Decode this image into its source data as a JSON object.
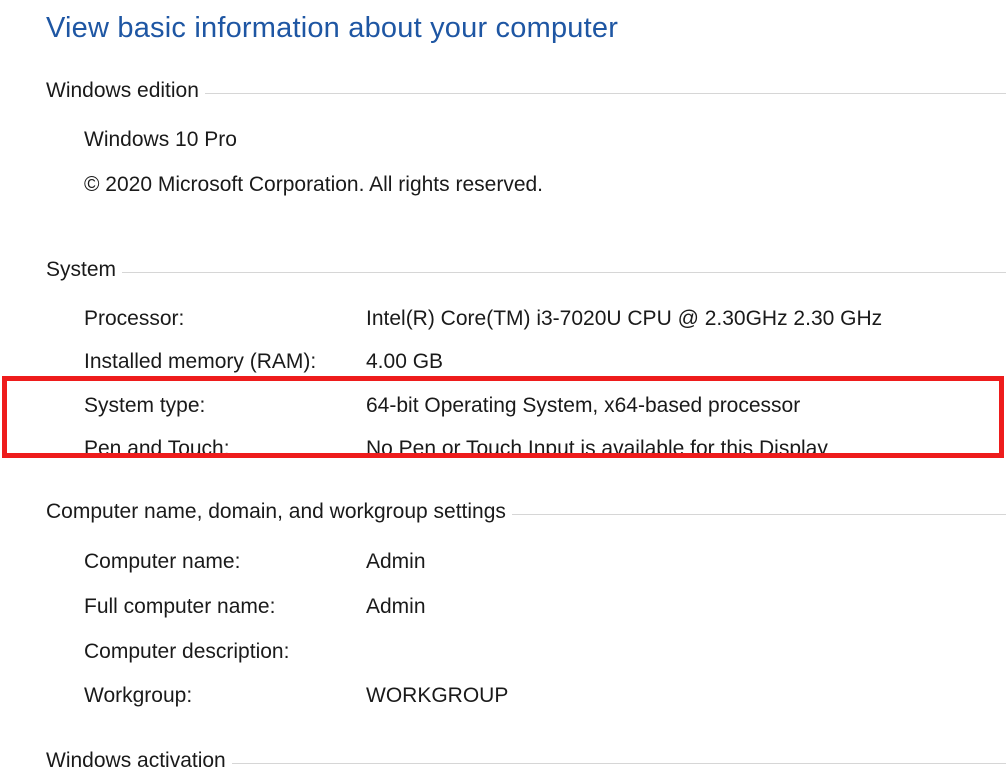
{
  "page_title": "View basic information about your computer",
  "sections": {
    "edition": {
      "header": "Windows edition",
      "name": "Windows 10 Pro",
      "copyright": "© 2020 Microsoft Corporation. All rights reserved."
    },
    "system": {
      "header": "System",
      "rows": [
        {
          "label": "Processor:",
          "value": "Intel(R) Core(TM) i3-7020U CPU @ 2.30GHz   2.30 GHz"
        },
        {
          "label": "Installed memory (RAM):",
          "value": "4.00 GB"
        },
        {
          "label": "System type:",
          "value": "64-bit Operating System, x64-based processor"
        },
        {
          "label": "Pen and Touch:",
          "value": "No Pen or Touch Input is available for this Display"
        }
      ]
    },
    "computer_name": {
      "header": "Computer name, domain, and workgroup settings",
      "rows": [
        {
          "label": "Computer name:",
          "value": "Admin"
        },
        {
          "label": "Full computer name:",
          "value": "Admin"
        },
        {
          "label": "Computer description:",
          "value": ""
        },
        {
          "label": "Workgroup:",
          "value": "WORKGROUP"
        }
      ]
    },
    "activation": {
      "header": "Windows activation"
    }
  },
  "colors": {
    "title": "#1e56a3",
    "highlight": "#ee1c1c",
    "rule": "#d6d6d6"
  }
}
